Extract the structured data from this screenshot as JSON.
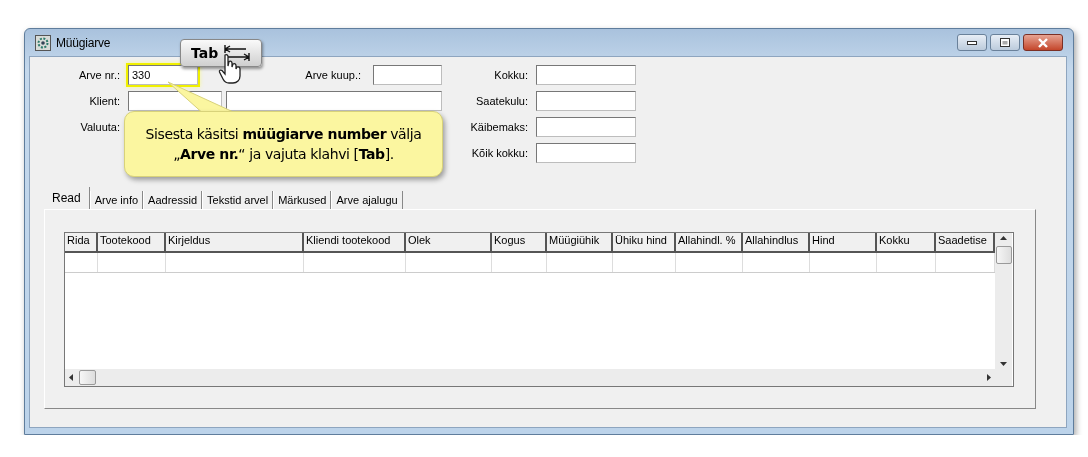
{
  "window": {
    "title": "Müügiarve"
  },
  "form": {
    "invoice_number": {
      "label": "Arve nr.:",
      "value": "330",
      "highlighted": true
    },
    "invoice_date": {
      "label": "Arve kuup.:"
    },
    "client": {
      "label": "Klient:"
    },
    "currency": {
      "label": "Valuuta:"
    },
    "totals": [
      {
        "label": "Kokku:"
      },
      {
        "label": "Saatekulu:"
      },
      {
        "label": "Käibemaks:"
      },
      {
        "label": "Kõik kokku:"
      }
    ]
  },
  "tabs": [
    {
      "label": "Read",
      "selected": true
    },
    {
      "label": "Arve info",
      "selected": false
    },
    {
      "label": "Aadressid",
      "selected": false
    },
    {
      "label": "Tekstid arvel",
      "selected": false
    },
    {
      "label": "Märkused",
      "selected": false
    },
    {
      "label": "Arve ajalugu",
      "selected": false
    }
  ],
  "table": {
    "columns": [
      "Rida",
      "Tootekood",
      "Kirjeldus",
      "Kliendi tootekood",
      "Olek",
      "Kogus",
      "Müügiühik",
      "Ühiku hind",
      "Allahindl. %",
      "Allahindlus",
      "Hind",
      "Kokku",
      "Saadetise"
    ]
  },
  "tab_key_hint": {
    "label": "Tab"
  },
  "callout": {
    "text": "Sisesta käsitsi **müügiarve number** välja\n„**Arve nr.**“ ja vajuta klahvi [**Tab**]."
  }
}
